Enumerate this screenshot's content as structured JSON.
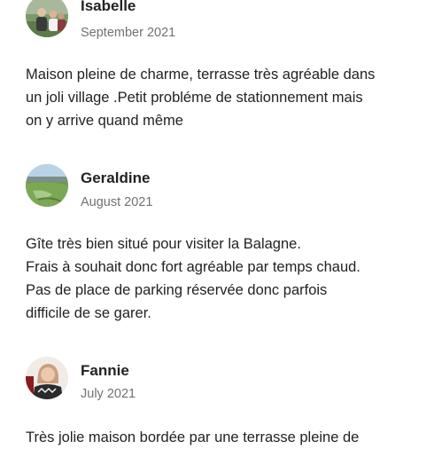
{
  "reviews": [
    {
      "name": "Isabelle",
      "date": "September 2021",
      "avatar_icon": "user-photo-icon",
      "lines": [
        "Maison pleine de charme, terrasse très agréable dans",
        "un joli village .Petit probléme de stationnement mais",
        "on y arrive quand même"
      ]
    },
    {
      "name": "Geraldine",
      "date": "August 2021",
      "avatar_icon": "landscape-photo-icon",
      "lines": [
        "Gîte très bien situé pour visiter la Balagne.",
        "Frais à souhait donc fort agréable par temps chaud.",
        "Pas de place de parking réservée donc parfois",
        "difficile de se garer."
      ]
    },
    {
      "name": "Fannie",
      "date": "July 2021",
      "avatar_icon": "user-photo-icon",
      "lines": [
        "Très jolie maison bordée par une terrasse pleine de"
      ]
    }
  ],
  "colors": {
    "text": "#222222",
    "secondary_text": "#717171",
    "background": "#ffffff"
  }
}
